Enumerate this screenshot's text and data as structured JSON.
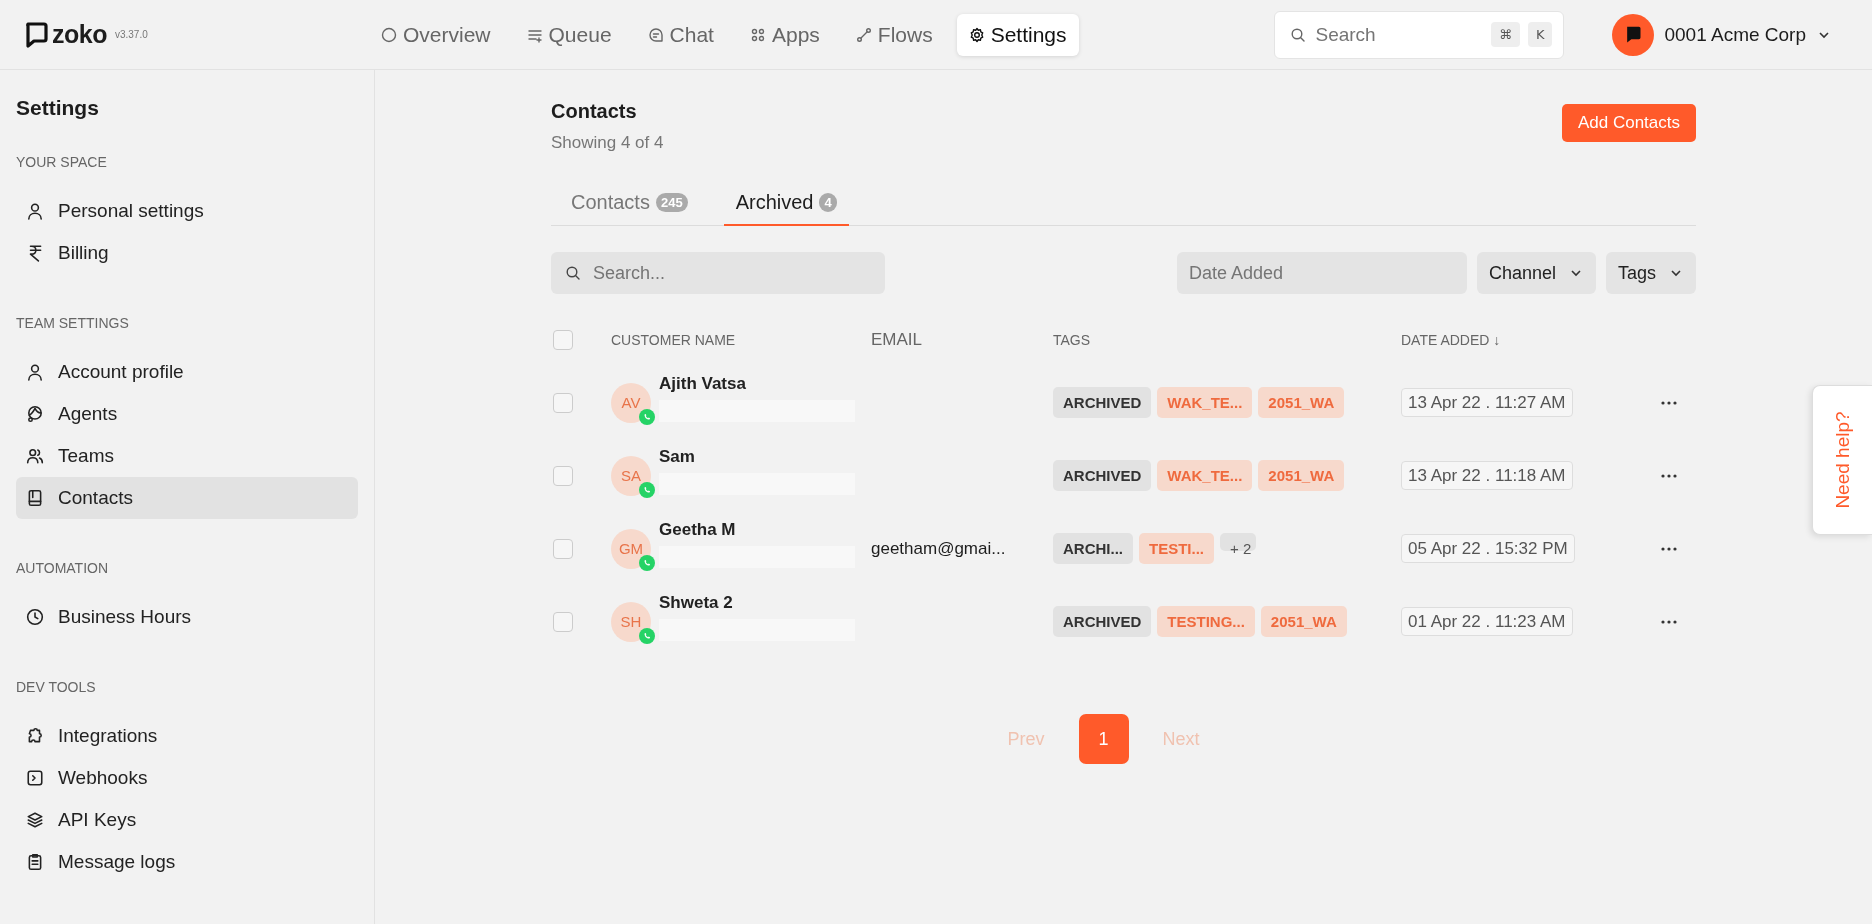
{
  "brand": {
    "name": "zoko",
    "version": "v3.37.0"
  },
  "nav": [
    {
      "label": "Overview",
      "selected": false
    },
    {
      "label": "Queue",
      "selected": false
    },
    {
      "label": "Chat",
      "selected": false
    },
    {
      "label": "Apps",
      "selected": false
    },
    {
      "label": "Flows",
      "selected": false
    },
    {
      "label": "Settings",
      "selected": true
    }
  ],
  "search": {
    "placeholder": "Search",
    "keys": [
      "⌘",
      "K"
    ]
  },
  "account": {
    "name": "0001 Acme Corp"
  },
  "sidebar": {
    "title": "Settings",
    "sections": [
      {
        "heading": "YOUR SPACE",
        "items": [
          {
            "label": "Personal settings",
            "selected": false
          },
          {
            "label": "Billing",
            "selected": false
          }
        ]
      },
      {
        "heading": "TEAM SETTINGS",
        "items": [
          {
            "label": "Account profile",
            "selected": false
          },
          {
            "label": "Agents",
            "selected": false
          },
          {
            "label": "Teams",
            "selected": false
          },
          {
            "label": "Contacts",
            "selected": true
          }
        ]
      },
      {
        "heading": "AUTOMATION",
        "items": [
          {
            "label": "Business Hours",
            "selected": false
          }
        ]
      },
      {
        "heading": "DEV TOOLS",
        "items": [
          {
            "label": "Integrations",
            "selected": false
          },
          {
            "label": "Webhooks",
            "selected": false
          },
          {
            "label": "API Keys",
            "selected": false
          },
          {
            "label": "Message logs",
            "selected": false
          }
        ]
      }
    ]
  },
  "page": {
    "title": "Contacts",
    "subtitle": "Showing 4 of 4",
    "add_button": "Add Contacts"
  },
  "tabs": [
    {
      "label": "Contacts",
      "count": "245",
      "selected": false
    },
    {
      "label": "Archived",
      "count": "4",
      "selected": true
    }
  ],
  "filters": {
    "search_placeholder": "Search...",
    "date_placeholder": "Date Added",
    "dropdowns": [
      "Channel",
      "Tags"
    ]
  },
  "table": {
    "select_all": {
      "checked": false
    },
    "columns": [
      "CUSTOMER NAME",
      "EMAIL",
      "TAGS",
      "DATE ADDED ↓"
    ],
    "rows": [
      {
        "initials": "AV",
        "name": "Ajith Vatsa",
        "email": "",
        "tags": [
          {
            "text": "ARCHIVED",
            "kind": "plain"
          },
          {
            "text": "WAK_TE...",
            "kind": "accent"
          },
          {
            "text": "2051_WA",
            "kind": "accent"
          }
        ],
        "date": "13 Apr 22 . 11:27 AM",
        "checked": false
      },
      {
        "initials": "SA",
        "name": "Sam",
        "email": "",
        "tags": [
          {
            "text": "ARCHIVED",
            "kind": "plain"
          },
          {
            "text": "WAK_TE...",
            "kind": "accent"
          },
          {
            "text": "2051_WA",
            "kind": "accent"
          }
        ],
        "date": "13 Apr 22 . 11:18 AM",
        "checked": false
      },
      {
        "initials": "GM",
        "name": "Geetha M",
        "email": "geetham@gmai...",
        "tags": [
          {
            "text": "ARCHI...",
            "kind": "plain"
          },
          {
            "text": "TESTI...",
            "kind": "accent"
          },
          {
            "text": "+ 2",
            "kind": "more"
          }
        ],
        "date": "05 Apr 22 . 15:32 PM",
        "checked": false
      },
      {
        "initials": "SH",
        "name": "Shweta 2",
        "email": "",
        "tags": [
          {
            "text": "ARCHIVED",
            "kind": "plain"
          },
          {
            "text": "TESTING...",
            "kind": "accent"
          },
          {
            "text": "2051_WA",
            "kind": "accent"
          }
        ],
        "date": "01 Apr 22 . 11:23 AM",
        "checked": false
      }
    ]
  },
  "pagination": {
    "prev": "Prev",
    "pages": [
      {
        "label": "1",
        "selected": true
      }
    ],
    "next": "Next"
  },
  "help": {
    "label": "Need help?"
  }
}
